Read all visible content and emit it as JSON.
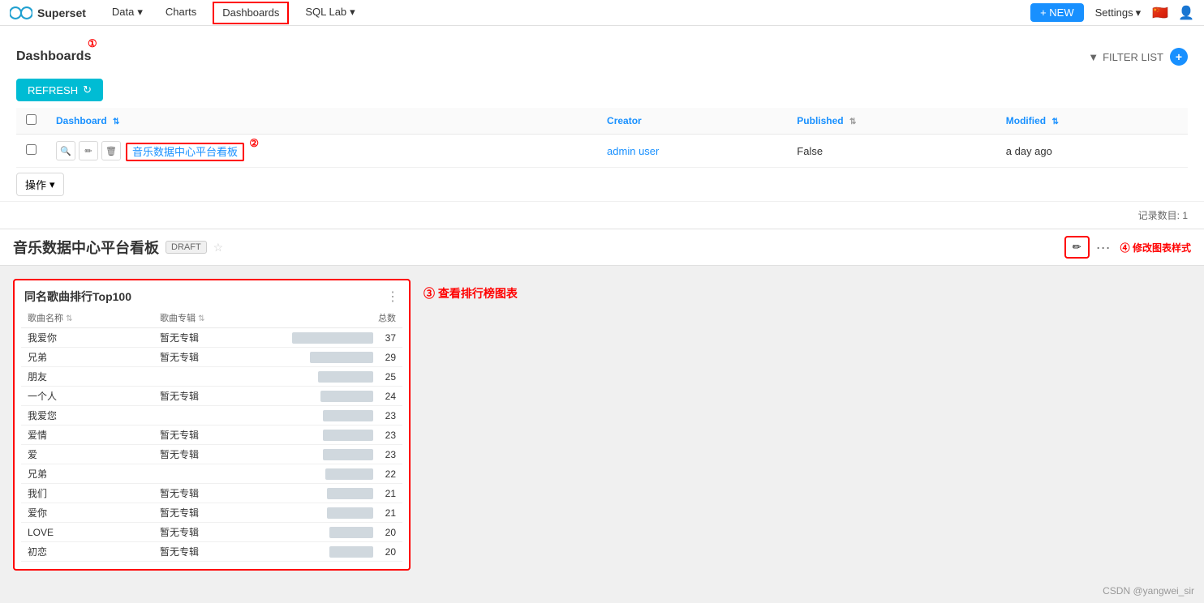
{
  "nav": {
    "brand": "Superset",
    "items": [
      {
        "label": "Data",
        "id": "data",
        "active": false,
        "hasDropdown": true
      },
      {
        "label": "Charts",
        "id": "charts",
        "active": false,
        "hasDropdown": false
      },
      {
        "label": "Dashboards",
        "id": "dashboards",
        "active": true,
        "hasDropdown": false,
        "highlighted": true
      },
      {
        "label": "SQL Lab",
        "id": "sqllab",
        "active": false,
        "hasDropdown": true
      }
    ],
    "new_button": "+ NEW",
    "settings_label": "Settings",
    "flag": "🇨🇳",
    "user_icon": "👤"
  },
  "dashboards_panel": {
    "title": "Dashboards",
    "filter_label": "FILTER LIST",
    "refresh_label": "REFRESH",
    "table": {
      "columns": [
        {
          "key": "dashboard",
          "label": "Dashboard"
        },
        {
          "key": "creator",
          "label": "Creator"
        },
        {
          "key": "published",
          "label": "Published"
        },
        {
          "key": "modified",
          "label": "Modified"
        }
      ],
      "rows": [
        {
          "dashboard": "音乐数据中心平台看板",
          "creator": "admin user",
          "published": "False",
          "modified": "a day ago"
        }
      ]
    },
    "record_count_label": "记录数目: 1",
    "operations_label": "操作"
  },
  "dashboard_view": {
    "title": "音乐数据中心平台看板",
    "draft_label": "DRAFT",
    "edit_icon": "✏",
    "more_icon": "···"
  },
  "chart_widget": {
    "title": "同名歌曲排行Top100",
    "menu_icon": "⋮",
    "columns": [
      {
        "label": "歌曲名称",
        "key": "name"
      },
      {
        "label": "歌曲专辑",
        "key": "album"
      },
      {
        "label": "总数",
        "key": "count"
      }
    ],
    "rows": [
      {
        "name": "我爱你",
        "album": "暂无专辑",
        "count": 37,
        "bar": 100
      },
      {
        "name": "兄弟",
        "album": "暂无专辑",
        "count": 29,
        "bar": 78
      },
      {
        "name": "朋友",
        "album": "",
        "count": 25,
        "bar": 68
      },
      {
        "name": "一个人",
        "album": "暂无专辑",
        "count": 24,
        "bar": 65
      },
      {
        "name": "我爱您",
        "album": "",
        "count": 23,
        "bar": 62
      },
      {
        "name": "爱情",
        "album": "暂无专辑",
        "count": 23,
        "bar": 62
      },
      {
        "name": "爱",
        "album": "暂无专辑",
        "count": 23,
        "bar": 62
      },
      {
        "name": "兄弟",
        "album": "",
        "count": 22,
        "bar": 59
      },
      {
        "name": "我们",
        "album": "暂无专辑",
        "count": 21,
        "bar": 57
      },
      {
        "name": "爱你",
        "album": "暂无专辑",
        "count": 21,
        "bar": 57
      },
      {
        "name": "LOVE",
        "album": "暂无专辑",
        "count": 20,
        "bar": 54
      },
      {
        "name": "初恋",
        "album": "暂无专辑",
        "count": 20,
        "bar": 54
      }
    ]
  },
  "annotations": {
    "circle1": "①",
    "circle2": "②",
    "circle3": "③",
    "circle4": "④",
    "label3": "③ 查看排行榜图表",
    "label4": "④ 修改图表样式"
  },
  "csdn": "CSDN @yangwei_sir"
}
